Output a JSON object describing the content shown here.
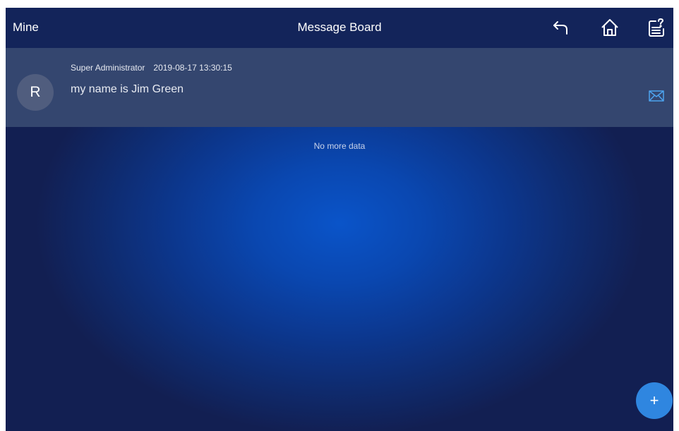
{
  "header": {
    "left_label": "Mine",
    "title": "Message Board",
    "icons": [
      "back-arrow-icon",
      "home-icon",
      "feedback-icon"
    ]
  },
  "messages": [
    {
      "avatar_letter": "R",
      "sender": "Super Administrator",
      "time": "2019-08-17 13:30:15",
      "text": "my name is Jim Green",
      "action_icon": "mail-icon"
    }
  ],
  "list_footer": "No more data",
  "fab": {
    "label": "+",
    "icon": "plus-icon"
  },
  "colors": {
    "header_bg": "#13245a",
    "row_bg": "#34466f",
    "avatar_bg": "#505d7e",
    "fab_bg": "#2f86e0",
    "mail_icon": "#4da3ee",
    "background_center": "#0a54c9",
    "background_edge": "#121f52"
  }
}
